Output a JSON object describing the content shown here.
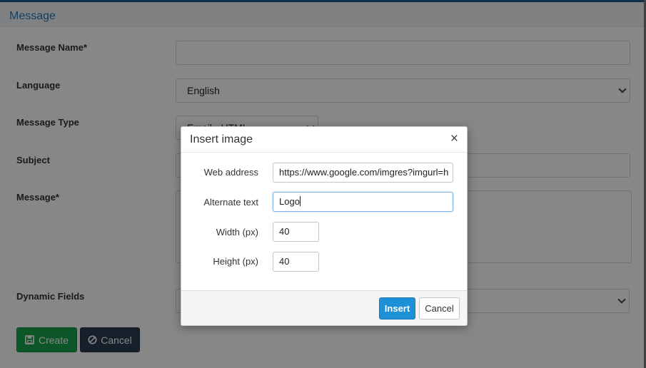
{
  "page": {
    "title": "Message",
    "fields": {
      "message_name_label": "Message Name*",
      "message_name_value": "",
      "language_label": "Language",
      "language_value": "English",
      "message_type_label": "Message Type",
      "message_type_value": "Email - HTML",
      "subject_label": "Subject",
      "message_label": "Message*",
      "dynamic_fields_label": "Dynamic Fields"
    },
    "buttons": {
      "create": "Create",
      "cancel": "Cancel"
    }
  },
  "modal": {
    "title": "Insert image",
    "close_glyph": "×",
    "web_address_label": "Web address",
    "web_address_value": "https://www.google.com/imgres?imgurl=h",
    "alt_text_label": "Alternate text",
    "alt_text_value": "Logo",
    "width_label": "Width (px)",
    "width_value": "40",
    "height_label": "Height (px)",
    "height_value": "40",
    "insert_label": "Insert",
    "cancel_label": "Cancel"
  },
  "colors": {
    "title": "#2a7ab8",
    "create_button": "#1aa34a",
    "cancel_button": "#2c3e50",
    "insert_button": "#1e90d6"
  }
}
